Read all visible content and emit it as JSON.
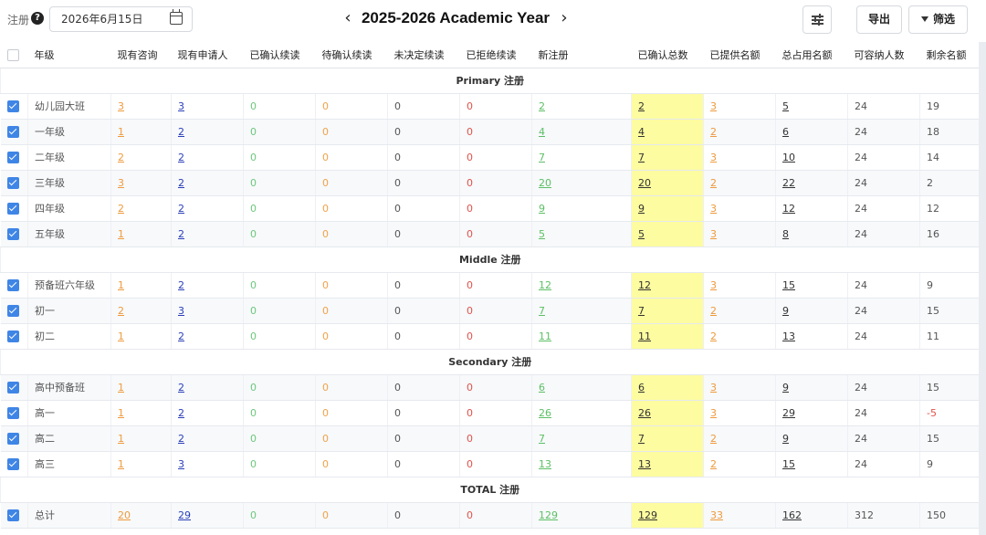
{
  "header": {
    "register_label": "注册",
    "help_icon": "question-circle-icon",
    "date_value": "2026年6月15日",
    "calendar_icon": "calendar-icon",
    "year_title": "2025-2026 Academic Year",
    "prev_icon": "chevron-left-icon",
    "next_icon": "chevron-right-icon",
    "settings_icon": "sliders-icon",
    "export_label": "导出",
    "filter_label": "筛选",
    "filter_icon": "funnel-icon"
  },
  "columns": [
    "年级",
    "现有咨询",
    "现有申请人",
    "已确认续读",
    "待确认续读",
    "未决定续读",
    "已拒绝续读",
    "新注册",
    "已确认总数",
    "已提供名额",
    "总占用名额",
    "可容纳人数",
    "剩余名额"
  ],
  "colors": {
    "checkbox": "#3f85e6",
    "highlight": "#fdfca0",
    "orange": "#ef9a3c",
    "blue": "#2a3fb8",
    "green": "#5cbf64",
    "red": "#e0524a"
  },
  "sections": [
    {
      "title": "Primary 注册",
      "rows": [
        {
          "grade": "幼儿园大班",
          "v": [
            "3",
            "3",
            "0",
            "0",
            "0",
            "0",
            "2",
            "2",
            "3",
            "5",
            "24",
            "19"
          ]
        },
        {
          "grade": "一年级",
          "v": [
            "1",
            "2",
            "0",
            "0",
            "0",
            "0",
            "4",
            "4",
            "2",
            "6",
            "24",
            "18"
          ]
        },
        {
          "grade": "二年级",
          "v": [
            "2",
            "2",
            "0",
            "0",
            "0",
            "0",
            "7",
            "7",
            "3",
            "10",
            "24",
            "14"
          ]
        },
        {
          "grade": "三年级",
          "v": [
            "3",
            "2",
            "0",
            "0",
            "0",
            "0",
            "20",
            "20",
            "2",
            "22",
            "24",
            "2"
          ]
        },
        {
          "grade": "四年级",
          "v": [
            "2",
            "2",
            "0",
            "0",
            "0",
            "0",
            "9",
            "9",
            "3",
            "12",
            "24",
            "12"
          ]
        },
        {
          "grade": "五年级",
          "v": [
            "1",
            "2",
            "0",
            "0",
            "0",
            "0",
            "5",
            "5",
            "3",
            "8",
            "24",
            "16"
          ]
        }
      ]
    },
    {
      "title": "Middle 注册",
      "rows": [
        {
          "grade": "预备班六年级",
          "v": [
            "1",
            "2",
            "0",
            "0",
            "0",
            "0",
            "12",
            "12",
            "3",
            "15",
            "24",
            "9"
          ]
        },
        {
          "grade": "初一",
          "v": [
            "2",
            "3",
            "0",
            "0",
            "0",
            "0",
            "7",
            "7",
            "2",
            "9",
            "24",
            "15"
          ]
        },
        {
          "grade": "初二",
          "v": [
            "1",
            "2",
            "0",
            "0",
            "0",
            "0",
            "11",
            "11",
            "2",
            "13",
            "24",
            "11"
          ]
        }
      ]
    },
    {
      "title": "Secondary 注册",
      "rows": [
        {
          "grade": "高中预备班",
          "v": [
            "1",
            "2",
            "0",
            "0",
            "0",
            "0",
            "6",
            "6",
            "3",
            "9",
            "24",
            "15"
          ]
        },
        {
          "grade": "高一",
          "v": [
            "1",
            "2",
            "0",
            "0",
            "0",
            "0",
            "26",
            "26",
            "3",
            "29",
            "24",
            "-5"
          ]
        },
        {
          "grade": "高二",
          "v": [
            "1",
            "2",
            "0",
            "0",
            "0",
            "0",
            "7",
            "7",
            "2",
            "9",
            "24",
            "15"
          ]
        },
        {
          "grade": "高三",
          "v": [
            "1",
            "3",
            "0",
            "0",
            "0",
            "0",
            "13",
            "13",
            "2",
            "15",
            "24",
            "9"
          ]
        }
      ]
    },
    {
      "title": "TOTAL 注册",
      "rows": [
        {
          "grade": "总计",
          "v": [
            "20",
            "29",
            "0",
            "0",
            "0",
            "0",
            "129",
            "129",
            "33",
            "162",
            "312",
            "150"
          ]
        }
      ]
    }
  ]
}
